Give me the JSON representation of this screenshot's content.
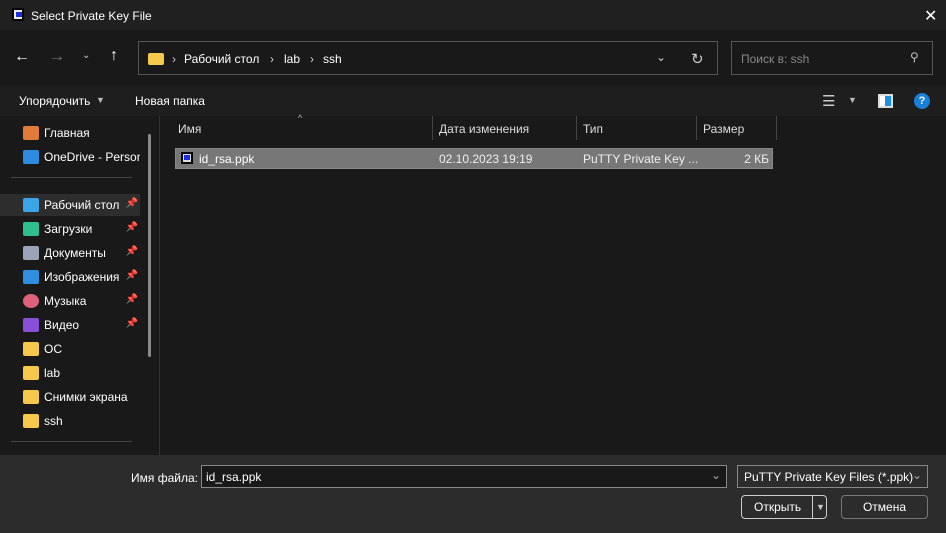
{
  "window": {
    "title": "Select Private Key File",
    "close_icon": "close-icon"
  },
  "nav": {
    "breadcrumb": [
      "Рабочий стол",
      "lab",
      "ssh"
    ],
    "search_placeholder": "Поиск в: ssh"
  },
  "toolbar": {
    "organize": "Упорядочить",
    "new_folder": "Новая папка"
  },
  "sidebar": {
    "items": [
      {
        "label": "Главная",
        "icon": "home-icon",
        "pinned": false
      },
      {
        "label": "OneDrive - Personal",
        "icon": "onedrive-icon",
        "pinned": false
      },
      {
        "label": "Рабочий стол",
        "icon": "desktop-icon",
        "pinned": true,
        "selected": true
      },
      {
        "label": "Загрузки",
        "icon": "download-icon",
        "pinned": true
      },
      {
        "label": "Документы",
        "icon": "documents-icon",
        "pinned": true
      },
      {
        "label": "Изображения",
        "icon": "pictures-icon",
        "pinned": true
      },
      {
        "label": "Музыка",
        "icon": "music-icon",
        "pinned": true
      },
      {
        "label": "Видео",
        "icon": "video-icon",
        "pinned": true
      },
      {
        "label": "ОС",
        "icon": "folder-icon",
        "pinned": false
      },
      {
        "label": "lab",
        "icon": "folder-icon",
        "pinned": false
      },
      {
        "label": "Снимки экрана",
        "icon": "folder-icon",
        "pinned": false
      },
      {
        "label": "ssh",
        "icon": "folder-icon",
        "pinned": false
      }
    ]
  },
  "columns": [
    "Имя",
    "Дата изменения",
    "Тип",
    "Размер"
  ],
  "files": [
    {
      "name": "id_rsa.ppk",
      "date": "02.10.2023 19:19",
      "type": "PuTTY Private Key ...",
      "size": "2 КБ"
    }
  ],
  "footer": {
    "filename_label": "Имя файла:",
    "filename_value": "id_rsa.ppk",
    "filter": "PuTTY Private Key Files (*.ppk)",
    "open": "Открыть",
    "cancel": "Отмена"
  }
}
